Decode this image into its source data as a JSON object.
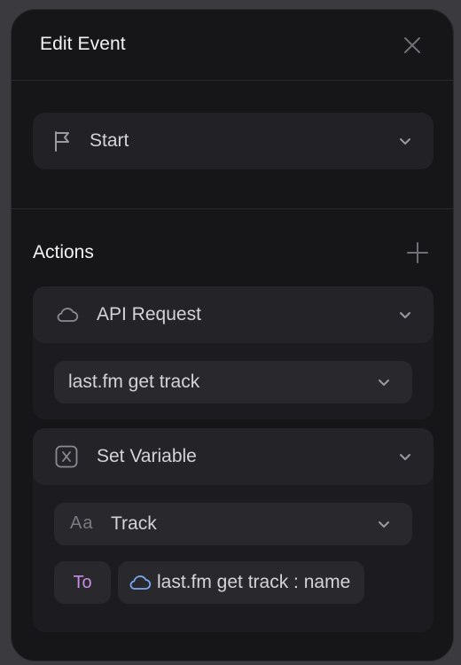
{
  "dialog": {
    "title": "Edit Event"
  },
  "trigger": {
    "label": "Start"
  },
  "actions": {
    "title": "Actions",
    "items": [
      {
        "type_label": "API Request",
        "select_value": "last.fm get track"
      },
      {
        "type_label": "Set Variable",
        "variable_icon_text": "Aa",
        "variable_value": "Track",
        "to_label": "To",
        "value_label": "last.fm get track : name"
      }
    ]
  },
  "colors": {
    "panel_bg": "#161619",
    "card_bg": "#1c1c20",
    "header_bg": "#242428",
    "input_bg": "#29292d",
    "to_accent": "#c78de6",
    "cloud_accent": "#7aa7f0"
  },
  "icons": {
    "close": "close-icon",
    "flag": "flag-icon",
    "add": "plus-icon",
    "cloud": "cloud-icon",
    "variable": "variable-icon",
    "text_type": "text-type-icon",
    "chevron": "chevron-down-icon"
  }
}
